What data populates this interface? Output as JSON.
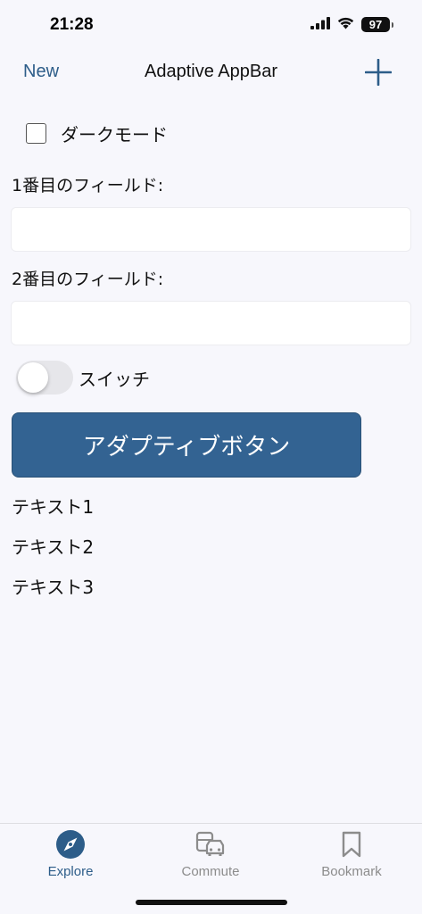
{
  "status_bar": {
    "time": "21:28",
    "battery": "97"
  },
  "app_bar": {
    "left_button": "New",
    "title": "Adaptive AppBar",
    "right_icon": "plus-icon",
    "accent_color": "#2d5d89"
  },
  "checkbox": {
    "label": "ダークモード",
    "checked": false
  },
  "fields": [
    {
      "label": "1番目のフィールド:",
      "value": ""
    },
    {
      "label": "2番目のフィールド:",
      "value": ""
    }
  ],
  "switch": {
    "label": "スイッチ",
    "on": false
  },
  "button": {
    "label": "アダプティブボタン",
    "color": "#336392"
  },
  "texts": [
    "テキスト1",
    "テキスト2",
    "テキスト3"
  ],
  "tab_bar": {
    "tabs": [
      {
        "label": "Explore",
        "icon": "compass-icon",
        "active": true
      },
      {
        "label": "Commute",
        "icon": "car-bus-icon",
        "active": false
      },
      {
        "label": "Bookmark",
        "icon": "bookmark-icon",
        "active": false
      }
    ]
  }
}
